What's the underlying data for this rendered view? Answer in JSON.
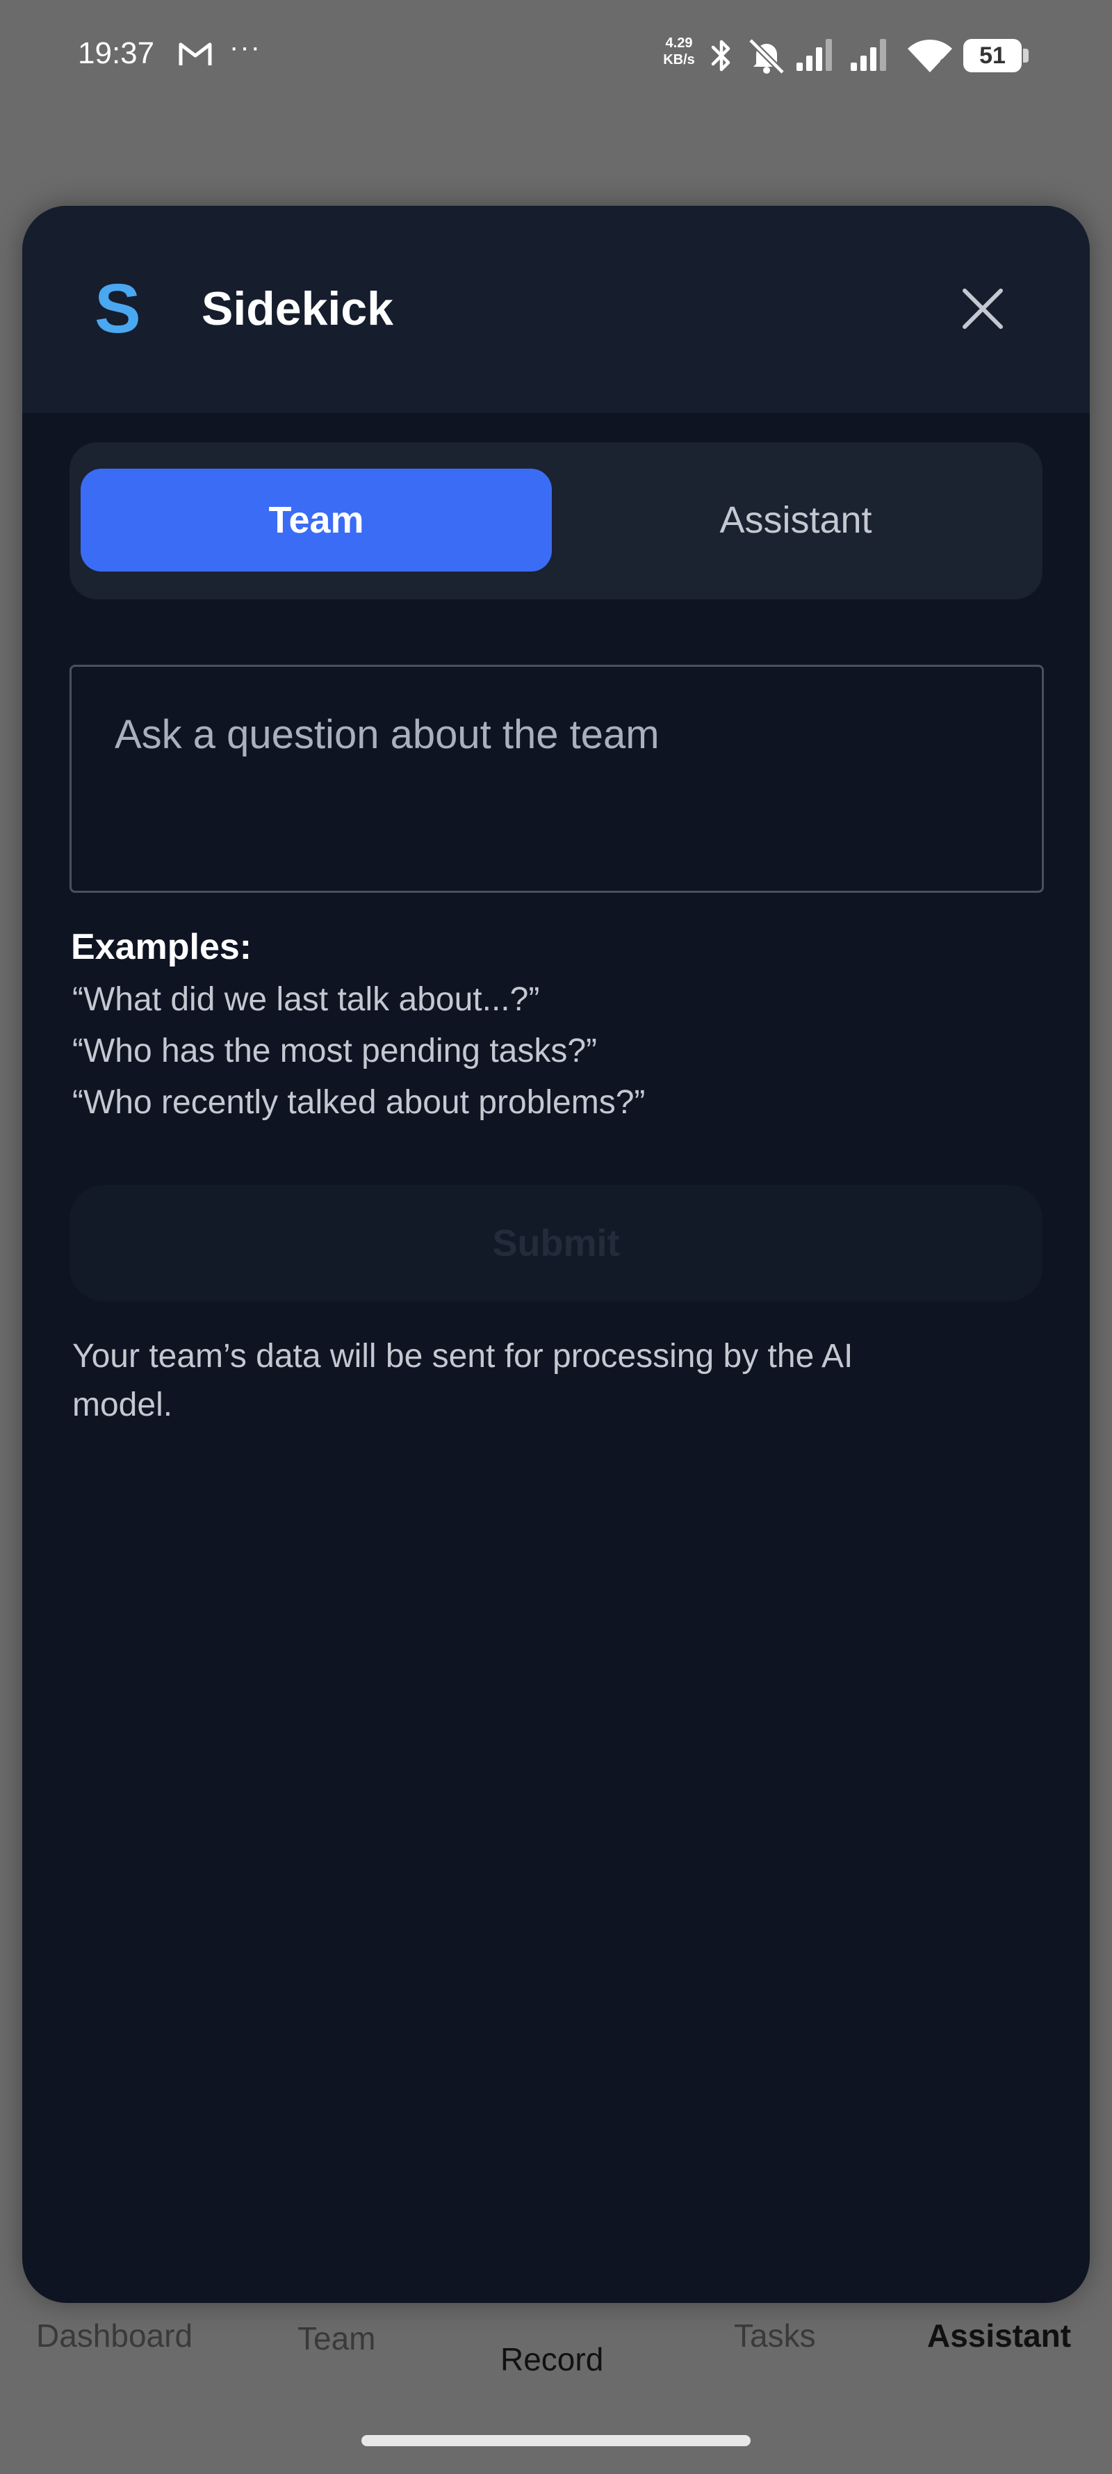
{
  "status_bar": {
    "time": "19:37",
    "net_speed_value": "4.29",
    "net_speed_unit": "KB/s",
    "battery": "51",
    "icons": [
      "gmail-icon",
      "more-dots-icon",
      "bluetooth-icon",
      "bell-off-icon",
      "signal-icon",
      "signal-icon",
      "wifi-icon",
      "battery-icon"
    ]
  },
  "modal": {
    "logo_letter": "S",
    "title": "Sidekick",
    "close_icon": "close-icon",
    "tabs": [
      {
        "label": "Team",
        "active": true
      },
      {
        "label": "Assistant",
        "active": false
      }
    ],
    "question_placeholder": "Ask a question about the team",
    "examples_heading": "Examples:",
    "examples": [
      "“What did we last talk about...?”",
      "“Who has the most pending tasks?”",
      "“Who recently talked about problems?”"
    ],
    "submit_label": "Submit",
    "disclaimer": "Your team’s data will be sent for processing by the AI model."
  },
  "bottom_nav": {
    "items": [
      {
        "label": "Dashboard",
        "active": false
      },
      {
        "label": "Team",
        "active": false
      },
      {
        "label": "Record",
        "active": false
      },
      {
        "label": "Tasks",
        "active": false
      },
      {
        "label": "Assistant",
        "active": true
      }
    ]
  },
  "colors": {
    "accent": "#3b6cf5",
    "logo": "#4aa8f0",
    "modal_bg": "#0e1422",
    "header_bg": "#161d2c",
    "overlay": "#6b6b6b"
  }
}
